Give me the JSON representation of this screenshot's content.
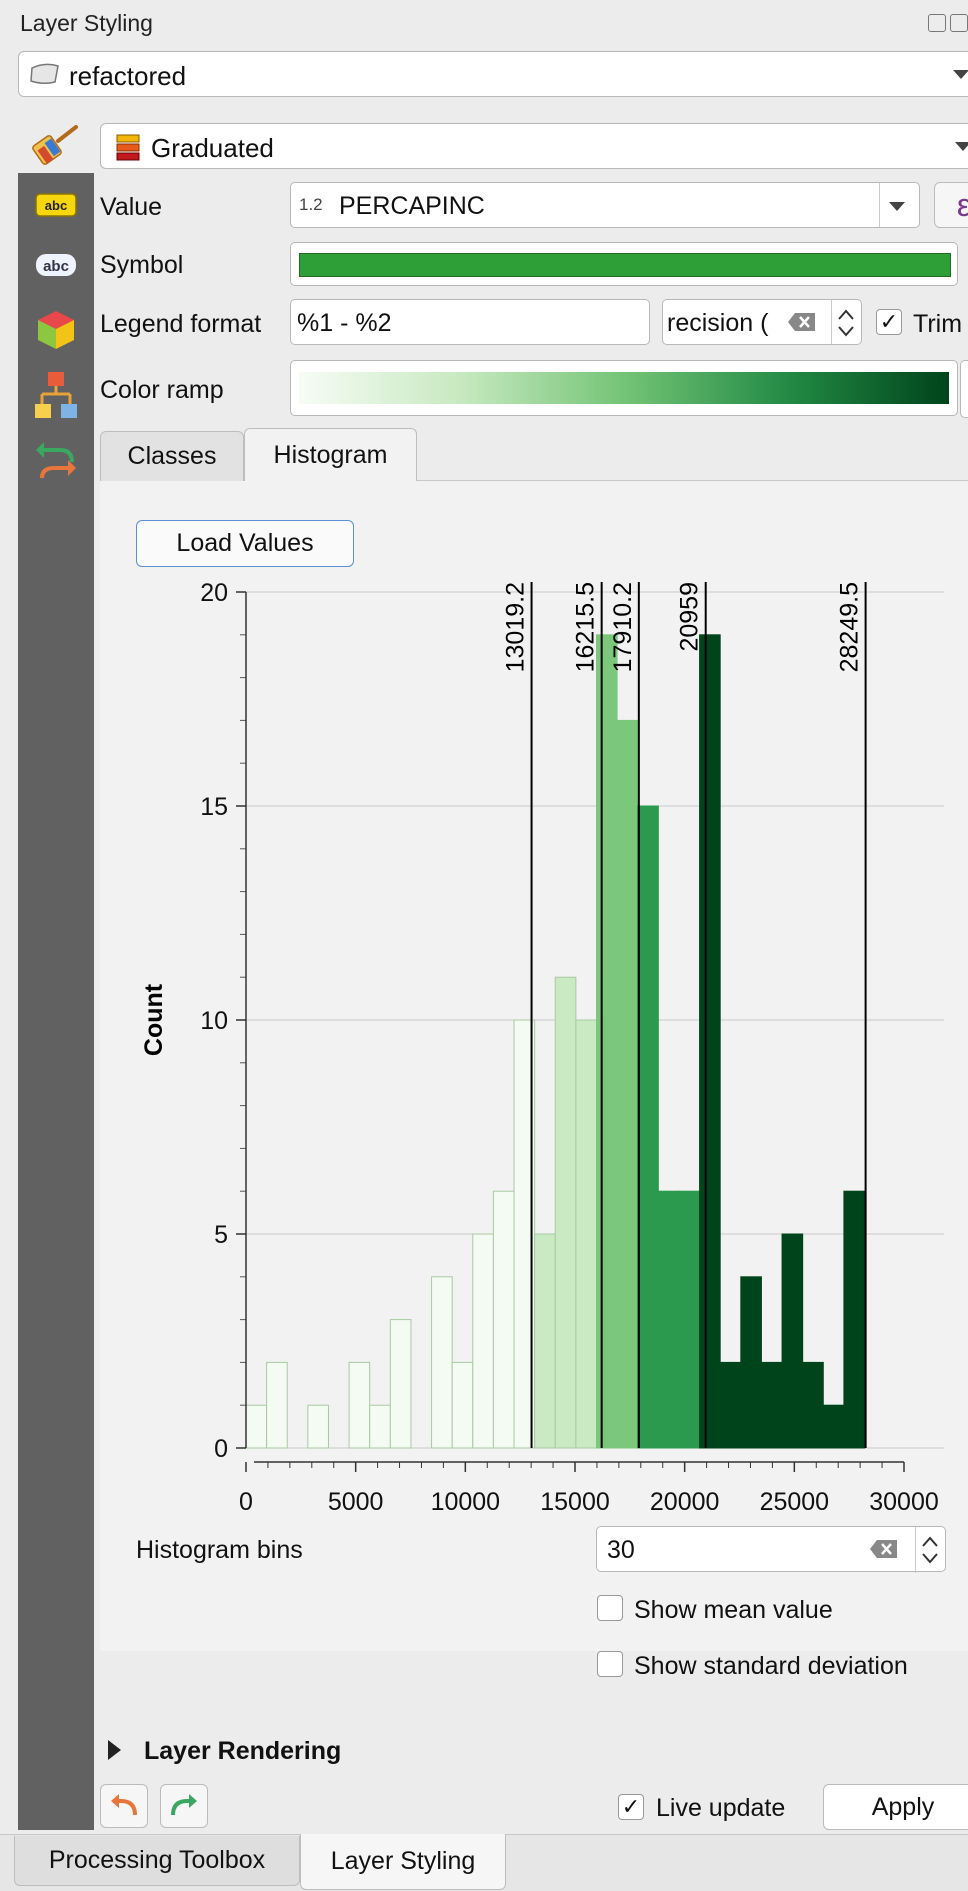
{
  "panel": {
    "title": "Layer Styling"
  },
  "layer": {
    "name": "refactored"
  },
  "renderer": {
    "type": "Graduated"
  },
  "fields": {
    "value_label": "Value",
    "value_type": "1.2",
    "value": "PERCAPINC",
    "expression_glyph": "ε",
    "symbol_label": "Symbol",
    "symbol_color": "#2e9e36",
    "legend_format_label": "Legend format",
    "legend_format": "%1 - %2",
    "precision_text": "recision (",
    "trim_label": "Trim",
    "trim_checked": true,
    "color_ramp_label": "Color ramp"
  },
  "tabs": [
    {
      "label": "Classes",
      "active": false
    },
    {
      "label": "Histogram",
      "active": true
    }
  ],
  "histogram": {
    "load_values_label": "Load Values",
    "bins_label": "Histogram bins",
    "bins_value": "30",
    "show_mean_label": "Show mean value",
    "show_mean_checked": false,
    "show_std_label": "Show standard deviation",
    "show_std_checked": false
  },
  "chart_data": {
    "type": "bar",
    "ylabel": "Count",
    "xlabel": "",
    "xlim": [
      0,
      30000
    ],
    "ylim": [
      0,
      20
    ],
    "x_ticks": [
      0,
      5000,
      10000,
      15000,
      20000,
      25000,
      30000
    ],
    "y_ticks": [
      0,
      5,
      10,
      15,
      20
    ],
    "bin_start": 0,
    "bin_width": 940,
    "counts": [
      1,
      2,
      0,
      1,
      0,
      2,
      1,
      3,
      0,
      4,
      2,
      5,
      6,
      10,
      5,
      11,
      10,
      19,
      17,
      15,
      6,
      6,
      19,
      2,
      4,
      2,
      5,
      2,
      1,
      6
    ],
    "breaks": [
      13019.2,
      16215.5,
      17910.2,
      20959,
      28249.5
    ],
    "break_labels": [
      "13019.2",
      "16215.5",
      "17910.2",
      "20959",
      "28249.5"
    ],
    "class_colors": [
      "#f4fbf2",
      "#c9eac2",
      "#7bc87c",
      "#2b9a4e",
      "#00441b"
    ],
    "grid": true
  },
  "rendering": {
    "label": "Layer Rendering"
  },
  "footer": {
    "live_update_label": "Live update",
    "live_update_checked": true,
    "apply_label": "Apply"
  },
  "bottom_tabs": [
    {
      "label": "Processing Toolbox",
      "active": false
    },
    {
      "label": "Layer Styling",
      "active": true
    }
  ]
}
